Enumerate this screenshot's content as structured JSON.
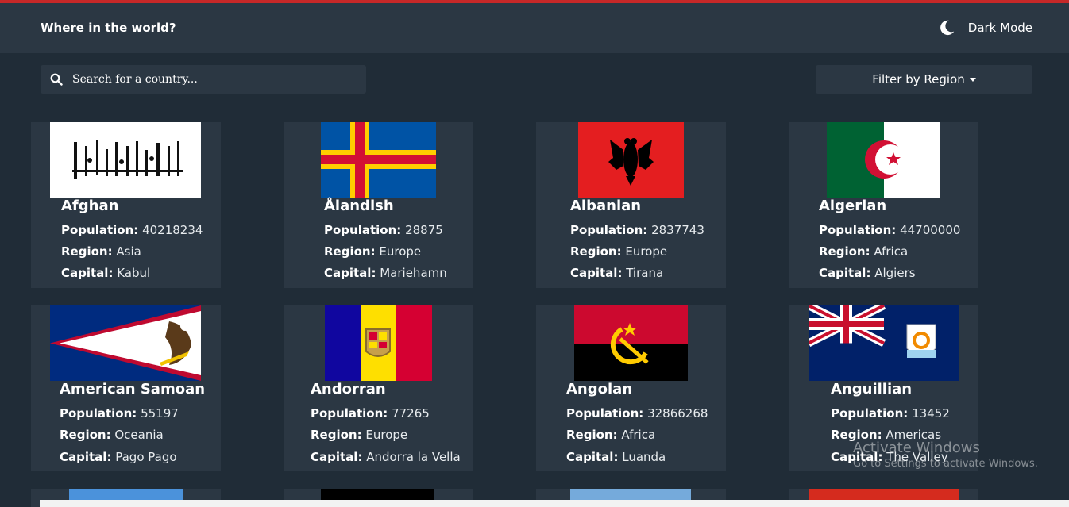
{
  "header": {
    "title": "Where in the world?",
    "theme_toggle_label": "Dark Mode"
  },
  "search": {
    "placeholder": "Search for a country..."
  },
  "filter": {
    "label": "Filter by Region"
  },
  "labels": {
    "population": "Population:",
    "region": "Region:",
    "capital": "Capital:"
  },
  "countries": [
    {
      "name": "Afghan",
      "population": "40218234",
      "region": "Asia",
      "capital": "Kabul"
    },
    {
      "name": "Ålandish",
      "population": "28875",
      "region": "Europe",
      "capital": "Mariehamn"
    },
    {
      "name": "Albanian",
      "population": "2837743",
      "region": "Europe",
      "capital": "Tirana"
    },
    {
      "name": "Algerian",
      "population": "44700000",
      "region": "Africa",
      "capital": "Algiers"
    },
    {
      "name": "American Samoan",
      "population": "55197",
      "region": "Oceania",
      "capital": "Pago Pago"
    },
    {
      "name": "Andorran",
      "population": "77265",
      "region": "Europe",
      "capital": "Andorra la Vella"
    },
    {
      "name": "Angolan",
      "population": "32866268",
      "region": "Africa",
      "capital": "Luanda"
    },
    {
      "name": "Anguillian",
      "population": "13452",
      "region": "Americas",
      "capital": "The Valley"
    }
  ],
  "watermark": {
    "line1": "Activate Windows",
    "line2": "Go to Settings to activate Windows."
  },
  "colors": {
    "background": "#202c37",
    "element": "#2b3743",
    "accent_top": "#c62828"
  }
}
